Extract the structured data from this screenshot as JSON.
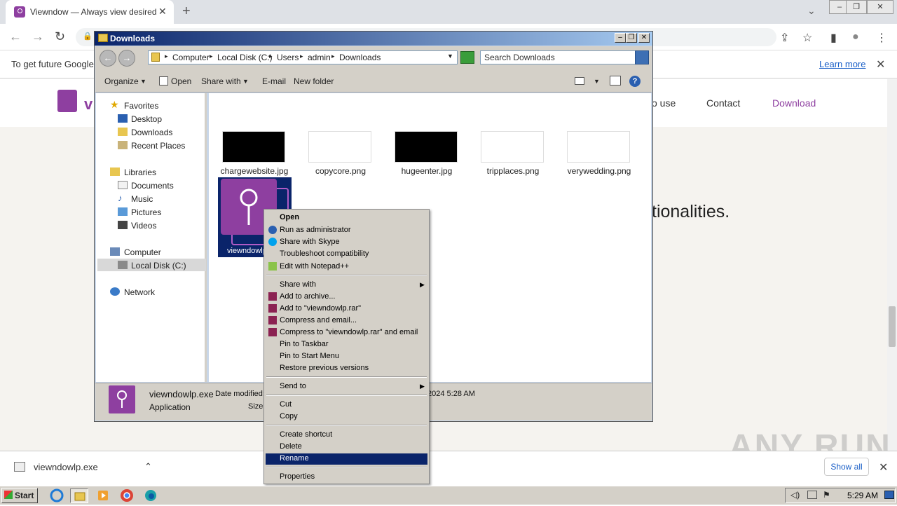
{
  "browser": {
    "tab_title": "Viewndow — Always view desired w...",
    "tab_close": "✕",
    "new_tab": "+",
    "tab_menu": "⌄",
    "nav_back": "←",
    "nav_forward": "→",
    "nav_reload": "↻",
    "infobar_text": "To get future Google",
    "infobar_link": "Learn more",
    "infobar_close": "✕",
    "lock": "🔒",
    "share": "⇪",
    "star": "☆",
    "sidepanel": "▮",
    "profile": "●",
    "menu": "⋮",
    "win_minimize": "‒",
    "win_restore": "❐",
    "win_close": "✕"
  },
  "website": {
    "logo_letter": "v",
    "nav_howto": "o use",
    "nav_contact": "Contact",
    "nav_download": "Download",
    "hero_fragment": "tionalities.",
    "watermark": "ANY RUN"
  },
  "explorer": {
    "title": "Downloads",
    "breadcrumbs": [
      "Computer",
      "Local Disk (C:)",
      "Users",
      "admin",
      "Downloads"
    ],
    "search_placeholder": "Search Downloads",
    "commands": {
      "organize": "Organize",
      "open": "Open",
      "share_with": "Share with",
      "email": "E-mail",
      "new_folder": "New folder"
    },
    "nav": {
      "favorites": "Favorites",
      "desktop": "Desktop",
      "downloads": "Downloads",
      "recent_places": "Recent Places",
      "libraries": "Libraries",
      "documents": "Documents",
      "music": "Music",
      "pictures": "Pictures",
      "videos": "Videos",
      "computer": "Computer",
      "local_disk": "Local Disk (C:)",
      "network": "Network"
    },
    "files": [
      {
        "name": "chargewebsite.jpg",
        "thumb": "#000000"
      },
      {
        "name": "copycore.png",
        "thumb": "#ffffff"
      },
      {
        "name": "hugeenter.jpg",
        "thumb": "#000000"
      },
      {
        "name": "tripplaces.png",
        "thumb": "#ffffff"
      },
      {
        "name": "verywedding.png",
        "thumb": "#ffffff"
      }
    ],
    "selected_file_label": "viewndowlp",
    "details": {
      "name": "viewndowlp.exe",
      "type": "Application",
      "modified_label": "Date modified:",
      "size_label": "Size:",
      "date_fragment": "2024 5:28 AM"
    }
  },
  "context_menu": {
    "items": [
      "Open",
      "Run as administrator",
      "Share with Skype",
      "Troubleshoot compatibility",
      "Edit with Notepad++",
      "Share with",
      "Add to archive...",
      "Add to \"viewndowlp.rar\"",
      "Compress and email...",
      "Compress to \"viewndowlp.rar\" and email",
      "Pin to Taskbar",
      "Pin to Start Menu",
      "Restore previous versions",
      "Send to",
      "Cut",
      "Copy",
      "Create shortcut",
      "Delete",
      "Rename",
      "Properties"
    ],
    "highlighted": "Rename"
  },
  "downloads_bar": {
    "filename": "viewndowlp.exe",
    "show_all": "Show all",
    "chevron": "⌃",
    "close": "✕"
  },
  "taskbar": {
    "start": "Start",
    "clock": "5:29 AM"
  },
  "colors": {
    "brand_purple": "#8e3fa0",
    "title_bar": "#0a246a",
    "link_blue": "#1a5fc7"
  }
}
